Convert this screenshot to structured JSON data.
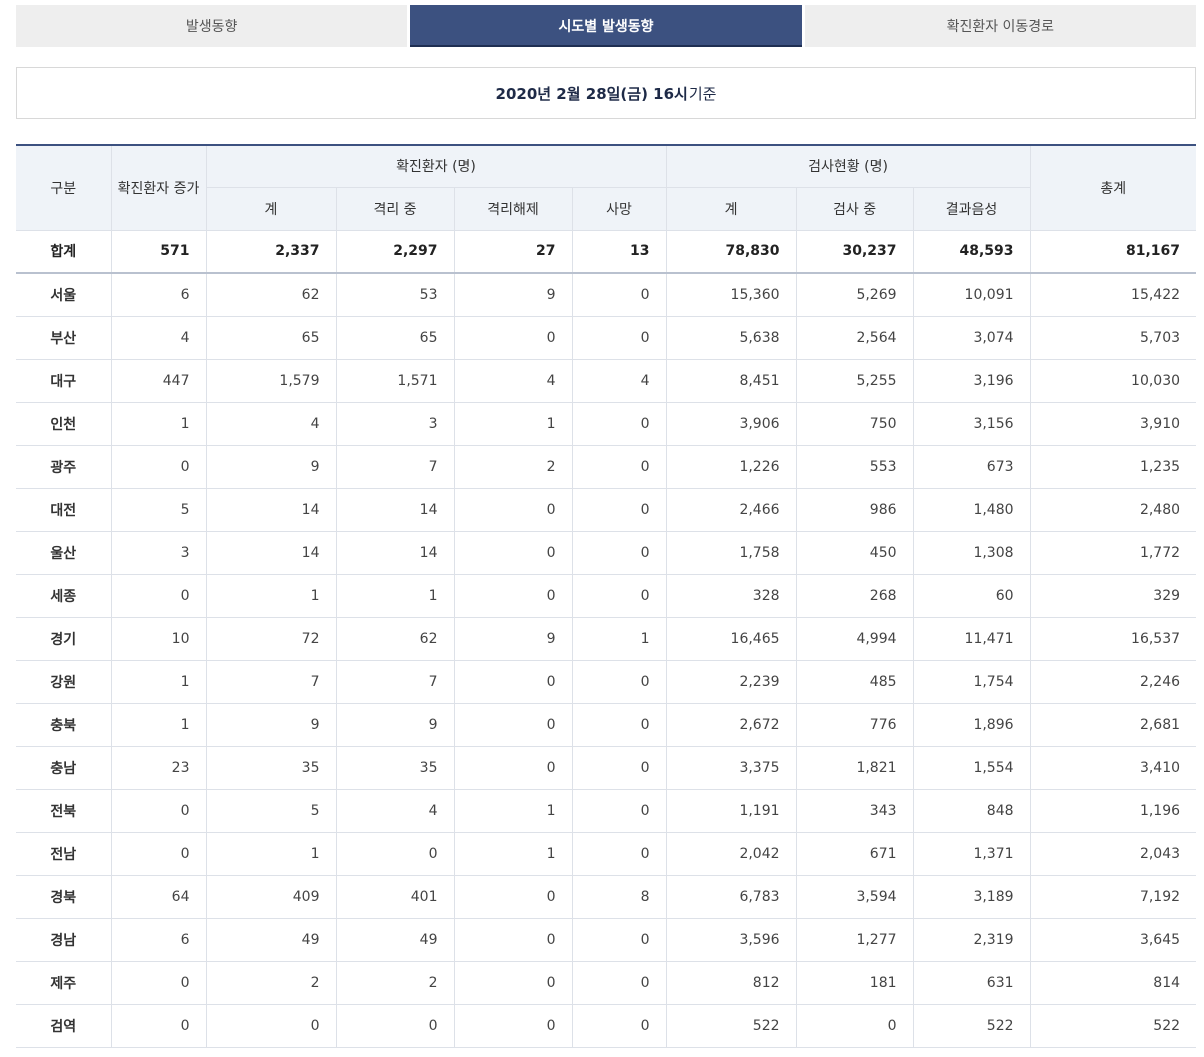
{
  "tabs": [
    {
      "label": "발생동향",
      "active": false
    },
    {
      "label": "시도별 발생동향",
      "active": true
    },
    {
      "label": "확진환자 이동경로",
      "active": false
    }
  ],
  "date": {
    "bold": "2020년 2월 28일(금) 16시",
    "normal": "기준"
  },
  "table": {
    "headers": {
      "region": "구분",
      "increase": "확진환자 증가",
      "confirmed_group": "확진환자 (명)",
      "test_group": "검사현황 (명)",
      "grand_total": "총계",
      "confirmed_sub": [
        "계",
        "격리 중",
        "격리해제",
        "사망"
      ],
      "test_sub": [
        "계",
        "검사 중",
        "결과음성"
      ]
    },
    "total": [
      "합계",
      "571",
      "2,337",
      "2,297",
      "27",
      "13",
      "78,830",
      "30,237",
      "48,593",
      "81,167"
    ],
    "rows": [
      [
        "서울",
        "6",
        "62",
        "53",
        "9",
        "0",
        "15,360",
        "5,269",
        "10,091",
        "15,422"
      ],
      [
        "부산",
        "4",
        "65",
        "65",
        "0",
        "0",
        "5,638",
        "2,564",
        "3,074",
        "5,703"
      ],
      [
        "대구",
        "447",
        "1,579",
        "1,571",
        "4",
        "4",
        "8,451",
        "5,255",
        "3,196",
        "10,030"
      ],
      [
        "인천",
        "1",
        "4",
        "3",
        "1",
        "0",
        "3,906",
        "750",
        "3,156",
        "3,910"
      ],
      [
        "광주",
        "0",
        "9",
        "7",
        "2",
        "0",
        "1,226",
        "553",
        "673",
        "1,235"
      ],
      [
        "대전",
        "5",
        "14",
        "14",
        "0",
        "0",
        "2,466",
        "986",
        "1,480",
        "2,480"
      ],
      [
        "울산",
        "3",
        "14",
        "14",
        "0",
        "0",
        "1,758",
        "450",
        "1,308",
        "1,772"
      ],
      [
        "세종",
        "0",
        "1",
        "1",
        "0",
        "0",
        "328",
        "268",
        "60",
        "329"
      ],
      [
        "경기",
        "10",
        "72",
        "62",
        "9",
        "1",
        "16,465",
        "4,994",
        "11,471",
        "16,537"
      ],
      [
        "강원",
        "1",
        "7",
        "7",
        "0",
        "0",
        "2,239",
        "485",
        "1,754",
        "2,246"
      ],
      [
        "충북",
        "1",
        "9",
        "9",
        "0",
        "0",
        "2,672",
        "776",
        "1,896",
        "2,681"
      ],
      [
        "충남",
        "23",
        "35",
        "35",
        "0",
        "0",
        "3,375",
        "1,821",
        "1,554",
        "3,410"
      ],
      [
        "전북",
        "0",
        "5",
        "4",
        "1",
        "0",
        "1,191",
        "343",
        "848",
        "1,196"
      ],
      [
        "전남",
        "0",
        "1",
        "0",
        "1",
        "0",
        "2,042",
        "671",
        "1,371",
        "2,043"
      ],
      [
        "경북",
        "64",
        "409",
        "401",
        "0",
        "8",
        "6,783",
        "3,594",
        "3,189",
        "7,192"
      ],
      [
        "경남",
        "6",
        "49",
        "49",
        "0",
        "0",
        "3,596",
        "1,277",
        "2,319",
        "3,645"
      ],
      [
        "제주",
        "0",
        "2",
        "2",
        "0",
        "0",
        "812",
        "181",
        "631",
        "814"
      ],
      [
        "검역",
        "0",
        "0",
        "0",
        "0",
        "0",
        "522",
        "0",
        "522",
        "522"
      ]
    ]
  },
  "colors": {
    "accent": "#3c5180",
    "header_bg": "#eff3f8",
    "border": "#dde1e8"
  }
}
